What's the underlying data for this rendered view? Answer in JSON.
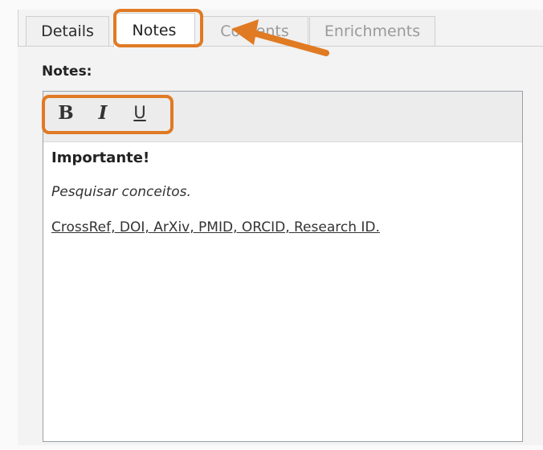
{
  "tabs": [
    {
      "label": "Details"
    },
    {
      "label": "Notes"
    },
    {
      "label": "Contents"
    },
    {
      "label": "Enrichments"
    }
  ],
  "notes_panel": {
    "label": "Notes:",
    "toolbar": {
      "bold_label": "B",
      "italic_label": "I",
      "underline_label": "U"
    },
    "content": {
      "line1": "Importante!",
      "line2": "Pesquisar conceitos.",
      "line3": "CrossRef, DOI, ArXiv, PMID, ORCID, Research ID."
    }
  },
  "colors": {
    "highlight": "#e07a23"
  }
}
